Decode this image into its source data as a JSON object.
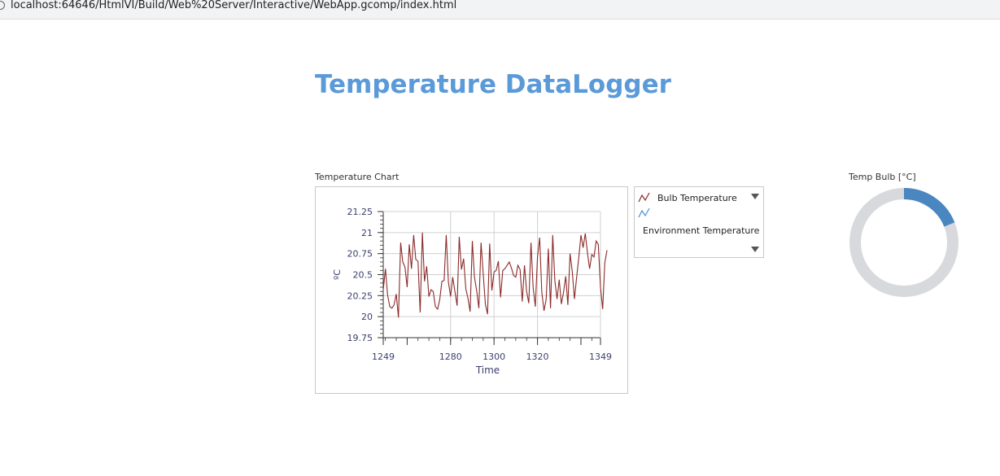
{
  "browser": {
    "url": "localhost:64646/HtmlVI/Build/Web%20Server/Interactive/WebApp.gcomp/index.html"
  },
  "page": {
    "title": "Temperature DataLogger"
  },
  "chart": {
    "label": "Temperature Chart"
  },
  "legend": {
    "items": [
      {
        "label": "Bulb Temperature",
        "color": "#8b2a2a",
        "icon": "line-series-icon"
      },
      {
        "label": "Environment Temperature",
        "color": "#4a90d9",
        "icon": "line-series-icon"
      }
    ]
  },
  "gauge": {
    "label": "Temp Bulb [°C]",
    "fill_fraction": 0.19,
    "fill_color": "#4a86c0",
    "track_color": "#d7d9dc"
  },
  "chart_data": {
    "type": "line",
    "title": "",
    "xlabel": "Time",
    "ylabel": "ºC",
    "xlim": [
      1249,
      1349
    ],
    "ylim": [
      19.75,
      21.25
    ],
    "x_ticks": [
      "1249",
      "1280",
      "1300",
      "1320",
      "1349"
    ],
    "y_ticks": [
      "21.25",
      "21",
      "20.75",
      "20.5",
      "20.25",
      "20",
      "19.75"
    ],
    "grid": true,
    "series": [
      {
        "name": "Bulb Temperature",
        "color": "#8b2a2a",
        "x_start": 1249,
        "x_step": 1,
        "values": [
          20.32,
          20.57,
          20.26,
          20.12,
          20.1,
          20.14,
          20.27,
          19.99,
          20.88,
          20.65,
          20.59,
          20.35,
          20.86,
          20.57,
          20.97,
          20.68,
          20.66,
          20.05,
          21.0,
          20.42,
          20.6,
          20.24,
          20.32,
          20.3,
          20.12,
          20.09,
          20.2,
          20.42,
          20.43,
          20.97,
          20.41,
          20.24,
          20.47,
          20.3,
          20.13,
          20.95,
          20.56,
          20.69,
          20.33,
          20.22,
          20.06,
          20.9,
          20.47,
          20.31,
          20.1,
          20.88,
          20.52,
          20.15,
          20.03,
          20.87,
          20.31,
          20.53,
          20.55,
          20.66,
          20.23,
          20.55,
          20.57,
          20.61,
          20.65,
          20.58,
          20.49,
          20.47,
          20.61,
          20.56,
          20.18,
          20.61,
          20.3,
          20.16,
          20.88,
          20.35,
          20.12,
          20.71,
          20.94,
          20.29,
          20.07,
          20.21,
          20.81,
          20.1,
          20.97,
          20.43,
          20.21,
          20.44,
          20.15,
          20.29,
          20.48,
          20.14,
          20.75,
          20.54,
          20.21,
          20.46,
          20.7,
          20.97,
          20.82,
          20.99,
          20.76,
          20.57,
          20.74,
          20.71,
          20.9,
          20.86,
          20.35,
          20.09,
          20.64,
          20.79
        ]
      }
    ]
  }
}
